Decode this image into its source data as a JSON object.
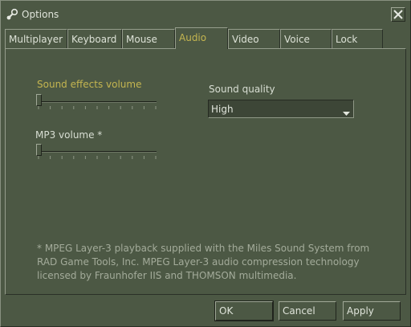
{
  "window": {
    "title": "Options"
  },
  "tabs": [
    {
      "label": "Multiplayer"
    },
    {
      "label": "Keyboard"
    },
    {
      "label": "Mouse"
    },
    {
      "label": "Audio",
      "active": true
    },
    {
      "label": "Video"
    },
    {
      "label": "Voice"
    },
    {
      "label": "Lock"
    }
  ],
  "audio": {
    "sound_effects_label": "Sound effects volume",
    "sound_effects_value": 0,
    "mp3_label": "MP3 volume *",
    "mp3_value": 0,
    "quality_label": "Sound quality",
    "quality_value": "High",
    "footnote": "* MPEG Layer-3 playback supplied with the Miles Sound System from RAD Game Tools, Inc. MPEG Layer-3 audio compression technology licensed by Fraunhofer IIS and THOMSON multimedia."
  },
  "buttons": {
    "ok": "OK",
    "cancel": "Cancel",
    "apply": "Apply"
  },
  "colors": {
    "background": "#4c5844",
    "highlight": "#c4b550"
  },
  "icons": {
    "title": "steam-icon",
    "close": "close-icon",
    "dropdown": "chevron-down-icon"
  }
}
